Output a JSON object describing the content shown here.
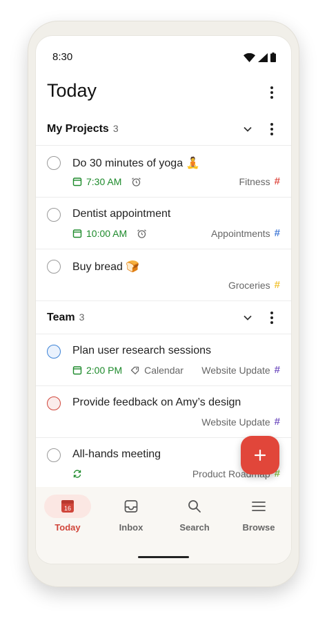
{
  "status_bar": {
    "time": "8:30"
  },
  "page": {
    "title": "Today"
  },
  "sections": [
    {
      "name": "My Projects",
      "count": "3",
      "tasks": [
        {
          "title": "Do 30 minutes of yoga 🧘",
          "time": "7:30 AM",
          "project": "Fitness",
          "project_color": "#e0524a"
        },
        {
          "title": "Dentist appointment",
          "time": "10:00 AM",
          "project": "Appointments",
          "project_color": "#4a7fd8"
        },
        {
          "title": "Buy bread 🍞",
          "project": "Groceries",
          "project_color": "#f2c53d"
        }
      ]
    },
    {
      "name": "Team",
      "count": "3",
      "tasks": [
        {
          "title": "Plan user research sessions",
          "time": "2:00 PM",
          "label": "Calendar",
          "project": "Website Update",
          "project_color": "#7b5cc4"
        },
        {
          "title": "Provide feedback on Amy’s design",
          "project": "Website Update",
          "project_color": "#7b5cc4"
        },
        {
          "title": "All-hands meeting",
          "project": "Product Roadmap",
          "project_color": "#8bc34a"
        }
      ]
    }
  ],
  "fab": {
    "icon": "plus-icon",
    "color": "#e1463a"
  },
  "bottom_nav": {
    "items": [
      {
        "label": "Today",
        "icon": "calendar-icon",
        "date": "16",
        "active": true
      },
      {
        "label": "Inbox",
        "icon": "inbox-icon"
      },
      {
        "label": "Search",
        "icon": "search-icon"
      },
      {
        "label": "Browse",
        "icon": "menu-icon"
      }
    ]
  },
  "colors": {
    "accent": "#d0453a",
    "due_green": "#1d8a2b"
  }
}
